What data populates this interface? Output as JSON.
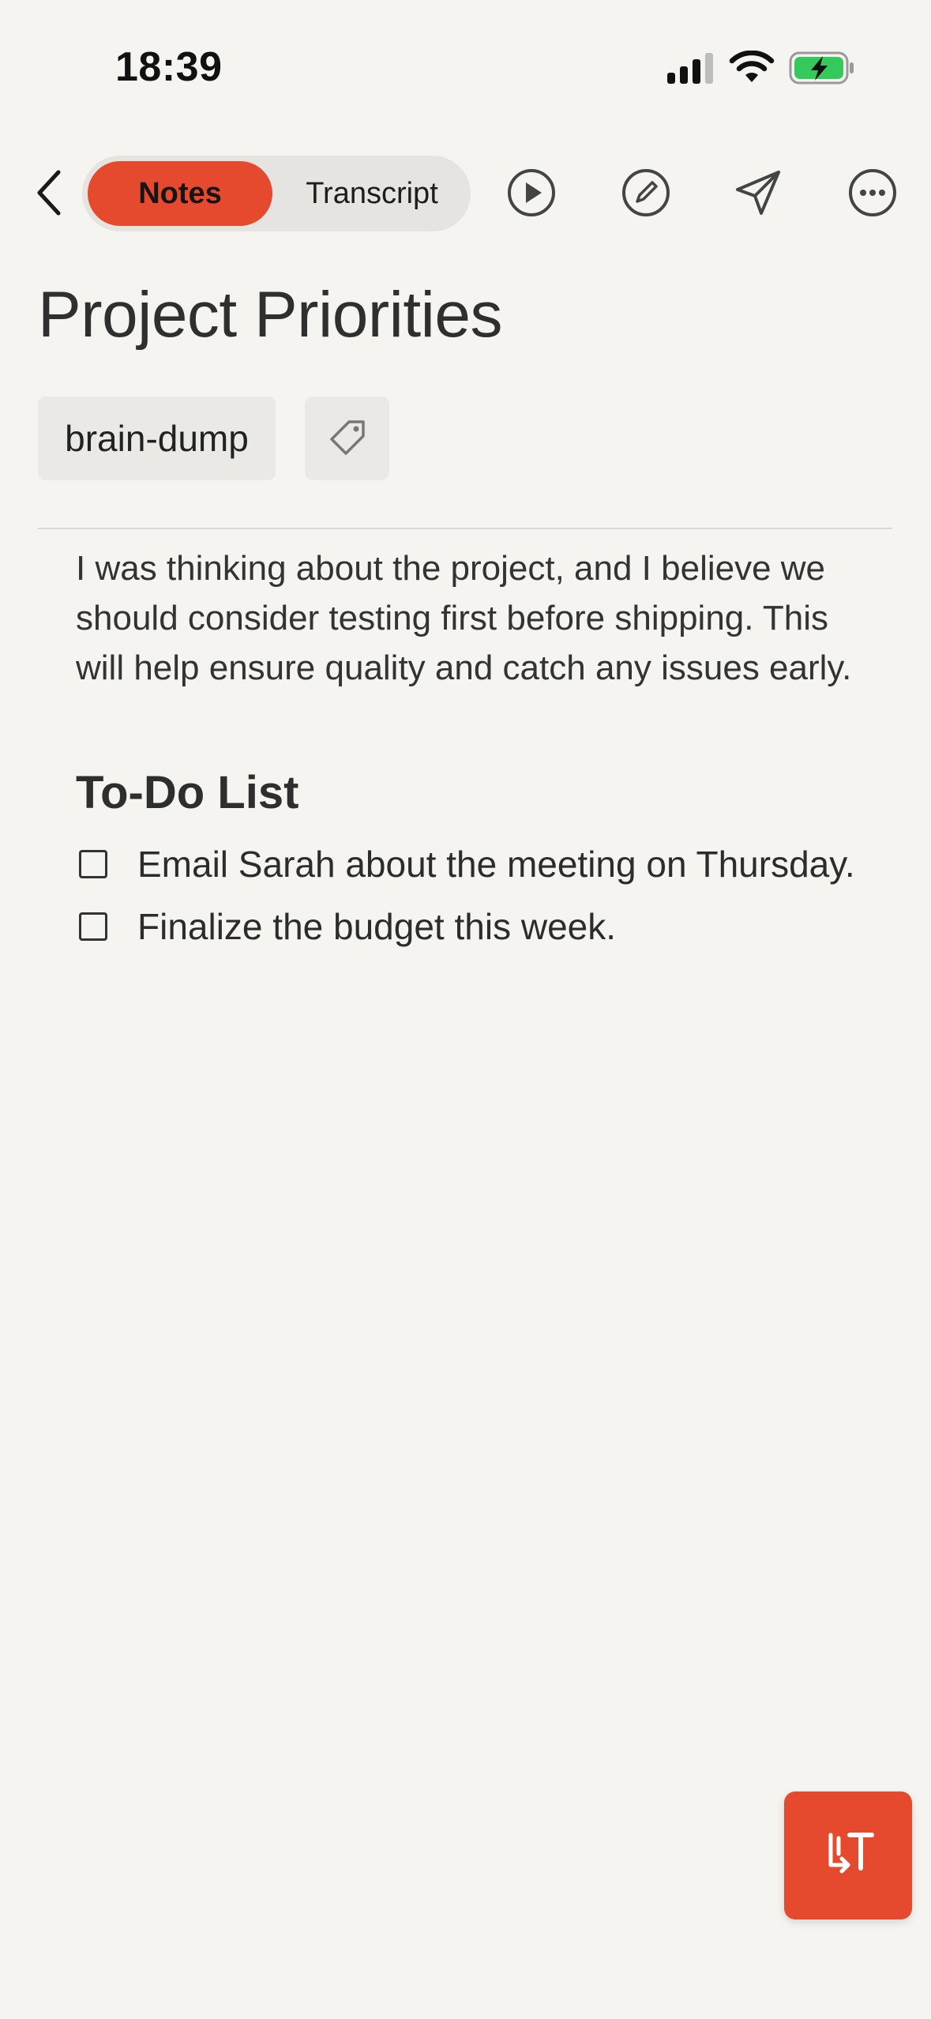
{
  "status_bar": {
    "time": "18:39",
    "icons": [
      "cellular-signal-icon",
      "wifi-icon",
      "battery-charging-icon"
    ]
  },
  "toolbar": {
    "back_icon": "chevron-left-icon",
    "tabs": [
      {
        "label": "Notes",
        "selected": true
      },
      {
        "label": "Transcript",
        "selected": false
      }
    ],
    "actions": [
      "play-icon",
      "edit-icon",
      "send-icon",
      "more-icon"
    ]
  },
  "note": {
    "title": "Project Priorities",
    "tags": [
      {
        "label": "brain-dump"
      }
    ],
    "add_tag_icon": "tag-icon",
    "paragraph": "I was thinking about the project, and I believe we should consider testing first before shipping. This will help ensure quality and catch any issues early.",
    "todo_heading": "To-Do List",
    "todos": [
      {
        "text": "Email Sarah about the meeting on Thursday.",
        "checked": false
      },
      {
        "text": "Finalize the budget this week.",
        "checked": false
      }
    ]
  },
  "fab": {
    "icon": "text-format-icon"
  },
  "colors": {
    "accent": "#e54a2e",
    "background": "#f5f4f1",
    "chip": "#ebe9e6"
  }
}
